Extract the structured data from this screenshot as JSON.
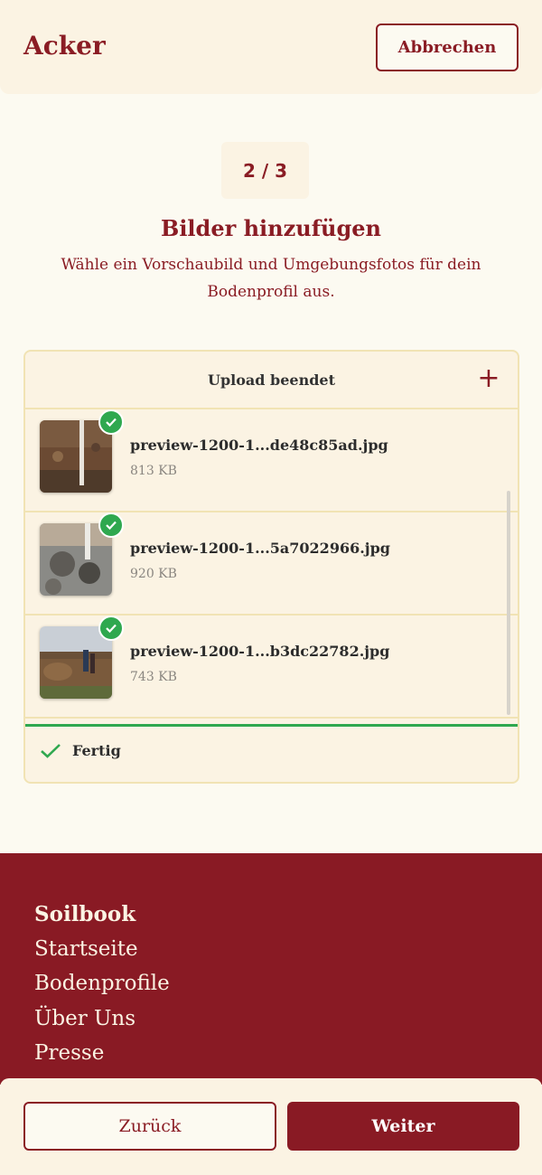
{
  "header": {
    "brand": "Acker",
    "cancel_label": "Abbrechen"
  },
  "step": {
    "indicator": "2 / 3"
  },
  "main": {
    "title": "Bilder hinzufügen",
    "subtitle": "Wähle ein Vorschaubild und Umgebungsfotos für dein Bodenprofil aus."
  },
  "upload": {
    "status": "Upload beendet",
    "add_icon": "plus-icon",
    "files": [
      {
        "name": "preview-1200-1...de48c85ad.jpg",
        "size": "813 KB"
      },
      {
        "name": "preview-1200-1...5a7022966.jpg",
        "size": "920 KB"
      },
      {
        "name": "preview-1200-1...b3dc22782.jpg",
        "size": "743 KB"
      }
    ],
    "done_label": "Fertig",
    "progress_percent": 100
  },
  "footer": {
    "brand": "Soilbook",
    "links": [
      "Startseite",
      "Bodenprofile",
      "Über Uns",
      "Presse"
    ]
  },
  "actions": {
    "back_label": "Zurück",
    "next_label": "Weiter"
  },
  "colors": {
    "primary": "#891a24",
    "background": "#fcfaf1",
    "panel": "#fbf3e3",
    "success": "#2fa84f"
  }
}
